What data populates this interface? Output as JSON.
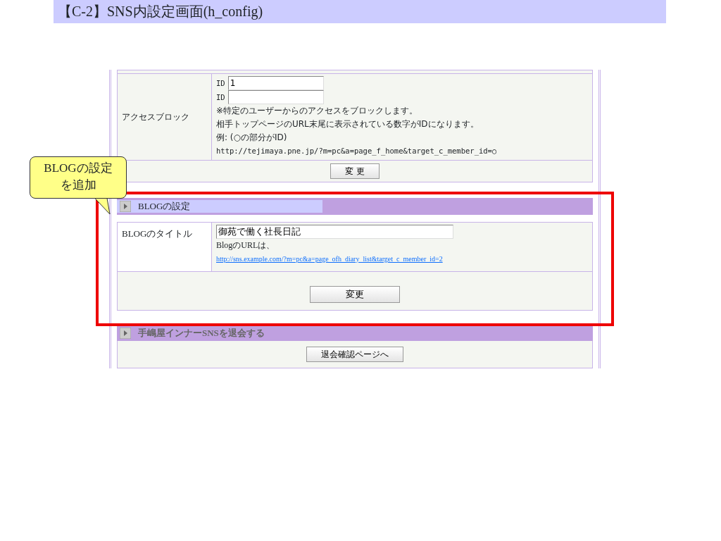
{
  "slide_title": "【C-2】SNS内設定画面(h_config)",
  "access_block": {
    "label": "アクセスブロック",
    "fields": [
      {
        "prefix": "ID",
        "value": "1"
      },
      {
        "prefix": "ID"
      }
    ],
    "notes": [
      "※特定のユーザーからのアクセスをブロックします。",
      "相手トップページのURL末尾に表示されている数字がIDになります。",
      "例: (○の部分がID)",
      "http://tejimaya.pne.jp/?m=pc&a=page_f_home&target_c_member_id=○"
    ],
    "button": "変 更"
  },
  "blog_section": {
    "header": "BLOGの設定",
    "title_label": "BLOGのタイトル",
    "title_value": "御苑で働く社長日記",
    "url_label": "BlogのURLは、",
    "url_link": "http://sns.example.com/?m=pc&a=page_ofh_diary_list&target_c_member_id=2",
    "button": "変更"
  },
  "withdraw_section": {
    "header": "手嶋屋インナーSNSを退会する",
    "button": "退会確認ページへ"
  },
  "callout": "BLOGの設定を追加"
}
